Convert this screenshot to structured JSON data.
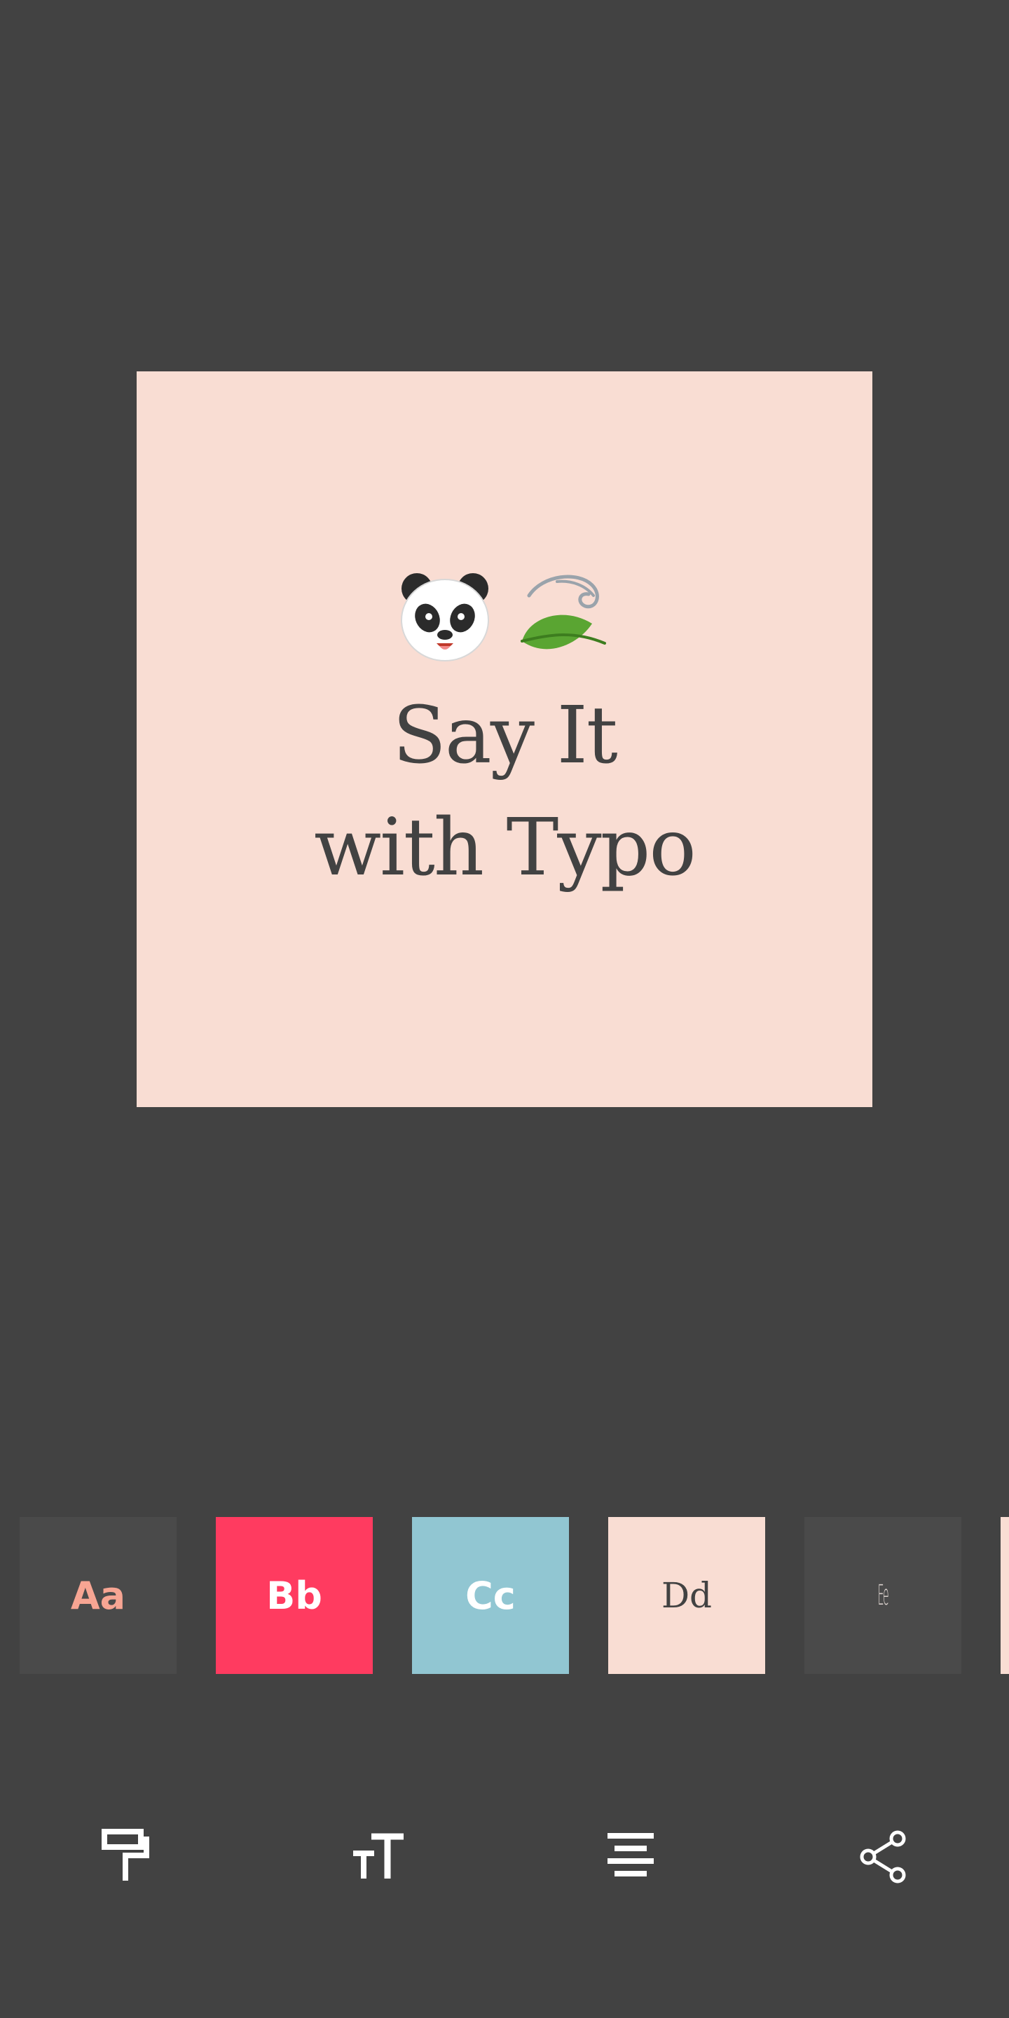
{
  "canvas": {
    "background": "#f9ddd3",
    "text_color": "#424242",
    "emojis": [
      "panda-face",
      "leaf-fluttering-in-wind"
    ],
    "lines": [
      "Say It",
      "with Typo"
    ]
  },
  "style_tiles": [
    {
      "label": "Aa",
      "background": "#4a4a4a",
      "color": "#f7a593"
    },
    {
      "label": "Bb",
      "background": "#ff3b60",
      "color": "#ffffff"
    },
    {
      "label": "Cc",
      "background": "#91c6d2",
      "color": "#ffffff"
    },
    {
      "label": "Dd",
      "background": "#f9ddd3",
      "color": "#424242"
    },
    {
      "label": "Ee",
      "background": "#4a4a4a",
      "color": "#d9d0cc"
    },
    {
      "label": "",
      "background": "#f9ddd3",
      "color": "#424242"
    }
  ],
  "toolbar": {
    "buttons": [
      "paint-roller-icon",
      "text-size-icon",
      "align-center-icon",
      "share-icon"
    ]
  },
  "colors": {
    "app_background": "#424242",
    "icon": "#ffffff"
  }
}
